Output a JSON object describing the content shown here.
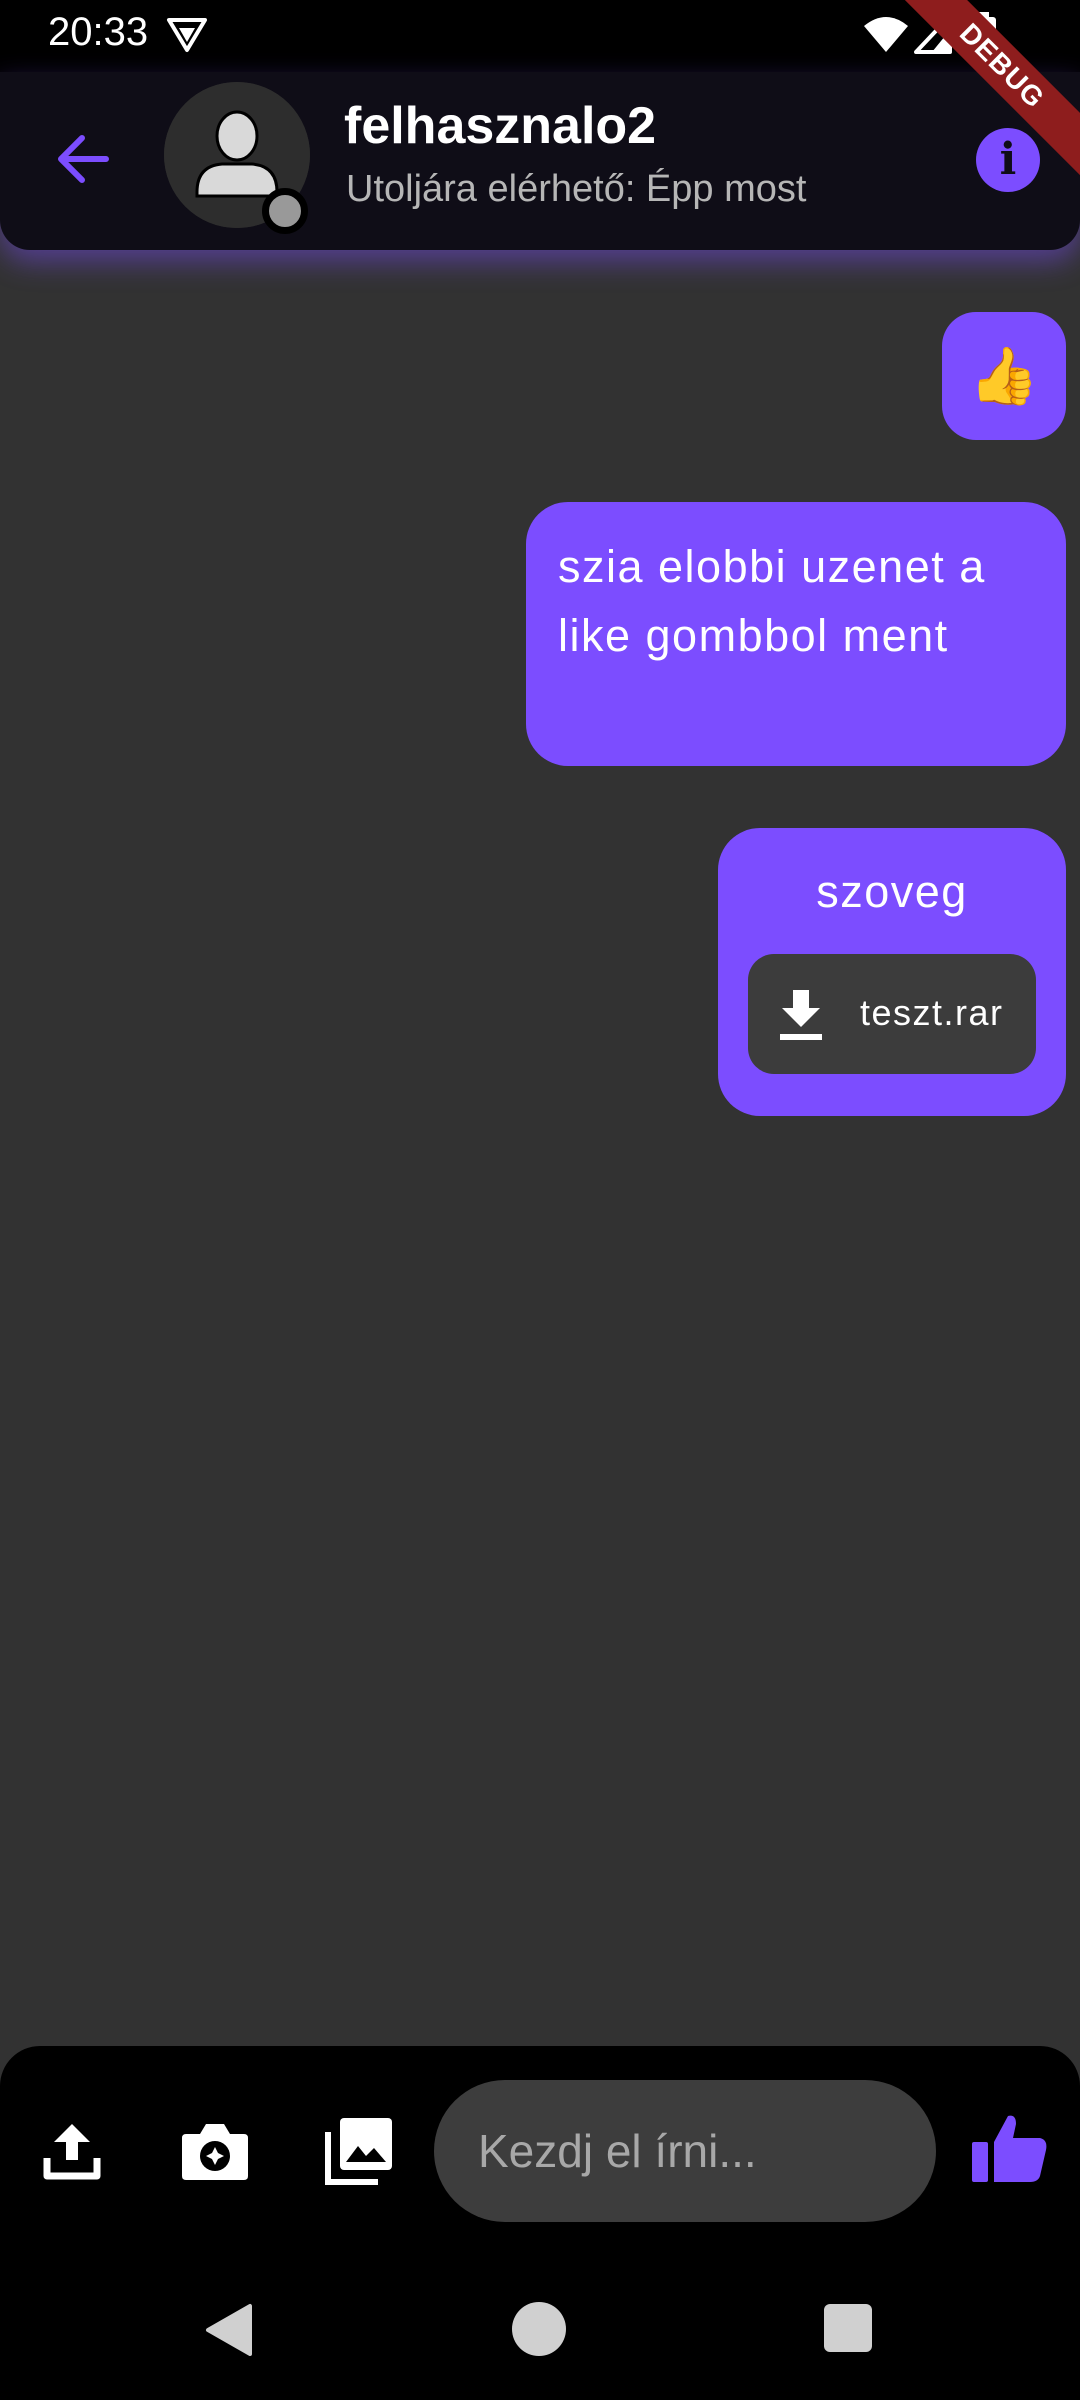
{
  "status_bar": {
    "time": "20:33",
    "icons": [
      "vpn-icon",
      "wifi-icon",
      "signal-icon",
      "battery-icon"
    ]
  },
  "debug_banner": "DEBUG",
  "header": {
    "contact_name": "felhasznalo2",
    "last_seen": "Utoljára elérhető: Épp most",
    "info_label": "i",
    "presence": "offline"
  },
  "messages": [
    {
      "type": "emoji",
      "text": "👍",
      "sent": true
    },
    {
      "type": "text",
      "text": "szia elobbi uzenet a like gombbol ment",
      "sent": true
    },
    {
      "type": "file",
      "caption": "szoveg",
      "file_name": "teszt.rar",
      "sent": true
    }
  ],
  "composer": {
    "placeholder": "Kezdj el írni...",
    "value": ""
  },
  "colors": {
    "accent": "#7c4dff",
    "background": "#323232",
    "header": "#0f0d17",
    "file_chip": "#3c3c3c",
    "input": "#3d3d3d",
    "debug": "#8e1d1d"
  }
}
